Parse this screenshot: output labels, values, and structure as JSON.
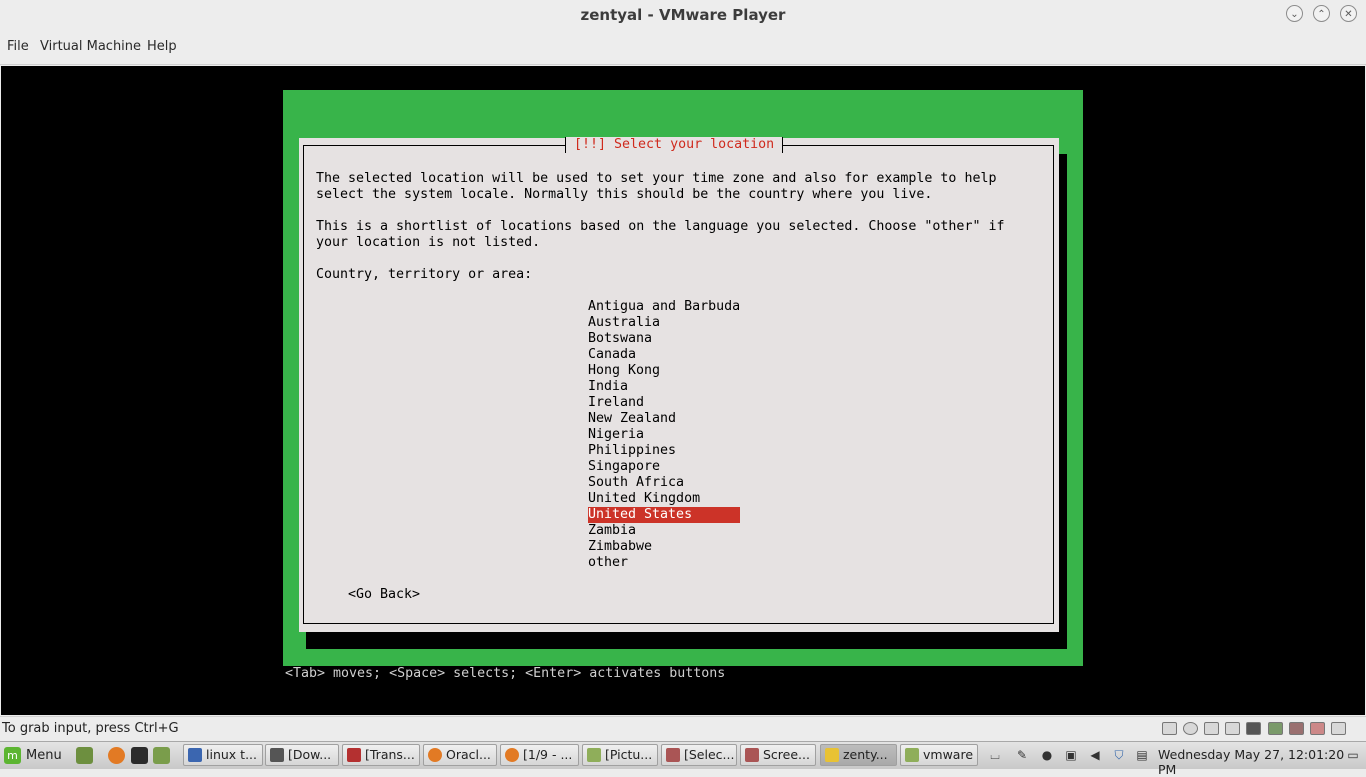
{
  "window": {
    "title": "zentyal - VMware Player",
    "minimize_glyph": "⌄",
    "maximize_glyph": "⌃",
    "close_glyph": "✕"
  },
  "menubar": {
    "file": "File",
    "virtual_machine": "Virtual Machine",
    "help": "Help"
  },
  "installer": {
    "dialog_title": "[!!] Select your location",
    "description_1": "The selected location will be used to set your time zone and also for example to help\nselect the system locale. Normally this should be the country where you live.",
    "description_2": "This is a shortlist of locations based on the language you selected. Choose \"other\" if\nyour location is not listed.",
    "prompt": "Country, territory or area:",
    "countries": [
      "Antigua and Barbuda",
      "Australia",
      "Botswana",
      "Canada",
      "Hong Kong",
      "India",
      "Ireland",
      "New Zealand",
      "Nigeria",
      "Philippines",
      "Singapore",
      "South Africa",
      "United Kingdom",
      "United States",
      "Zambia",
      "Zimbabwe",
      "other"
    ],
    "selected_country": "United States",
    "go_back": "<Go Back>",
    "hint": "<Tab> moves; <Space> selects; <Enter> activates buttons",
    "colors": {
      "frame_green": "#38b44a",
      "dialog_bg": "#e6e2e2",
      "title_red": "#cf2a1d",
      "selection_red": "#cc3328"
    }
  },
  "statusbar": {
    "text": "To grab input, press Ctrl+G"
  },
  "taskbar": {
    "menu_label": "Menu",
    "tasks": [
      {
        "label": "linux t...",
        "icon": "document-icon"
      },
      {
        "label": "[Dow...",
        "icon": "terminal-icon"
      },
      {
        "label": "[Trans...",
        "icon": "transmission-icon"
      },
      {
        "label": "Oracl...",
        "icon": "firefox-icon"
      },
      {
        "label": "[1/9 - ...",
        "icon": "firefox-icon"
      },
      {
        "label": "[Pictu...",
        "icon": "folder-icon"
      },
      {
        "label": "[Selec...",
        "icon": "screenshot-icon"
      },
      {
        "label": "Scree...",
        "icon": "screenshot-icon"
      },
      {
        "label": "zenty...",
        "icon": "vmware-icon"
      },
      {
        "label": "vmware",
        "icon": "folder-icon"
      }
    ],
    "active_task": "zenty...",
    "clock": "Wednesday May 27, 12:01:20 PM"
  }
}
